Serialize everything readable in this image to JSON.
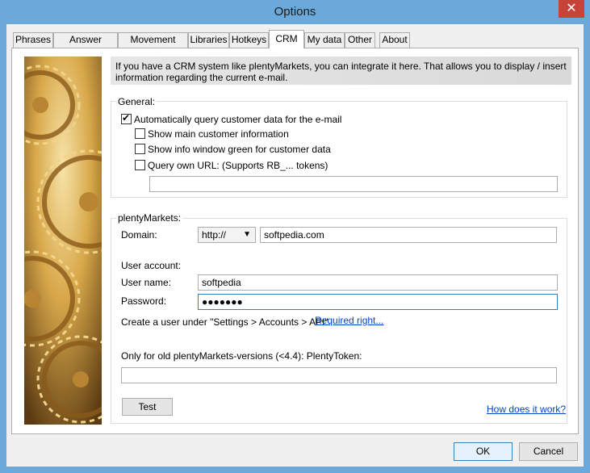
{
  "window": {
    "title": "Options",
    "close_glyph": "✕"
  },
  "tabs": [
    {
      "label": "Phrases"
    },
    {
      "label": "Answer details"
    },
    {
      "label": "Movement rules"
    },
    {
      "label": "Libraries"
    },
    {
      "label": "Hotkeys"
    },
    {
      "label": "CRM"
    },
    {
      "label": "My data"
    },
    {
      "label": "Other"
    },
    {
      "label": "About"
    }
  ],
  "active_tab": "CRM",
  "info": {
    "text": "If you have a CRM system like plentyMarkets, you can integrate it here. That allows you to display / insert information regarding the current e-mail."
  },
  "general": {
    "title": "General:",
    "auto_query": {
      "label": "Automatically query customer data for the e-mail",
      "checked": true
    },
    "show_main": {
      "label": "Show main customer information",
      "checked": false
    },
    "show_green": {
      "label": "Show info window green for customer data",
      "checked": false
    },
    "query_url": {
      "label": "Query own URL: (Supports RB_... tokens)",
      "checked": false
    },
    "url_value": ""
  },
  "plenty": {
    "title": "plentyMarkets:",
    "domain_label": "Domain:",
    "protocol": "http://",
    "domain_value": "softpedia.com",
    "user_account_label": "User account:",
    "username_label": "User name:",
    "username_value": "softpedia",
    "password_label": "Password:",
    "password_value": "●●●●●●●",
    "create_user_text": "Create a user under \"Settings > Accounts > API\".",
    "required_link": "Required right...",
    "token_label": "Only for old plentyMarkets-versions (<4.4): PlentyToken:",
    "token_value": "",
    "test_button": "Test",
    "how_link": "How does it work?"
  },
  "footer": {
    "ok": "OK",
    "cancel": "Cancel"
  },
  "colors": {
    "titlebar": "#6aa9da",
    "close": "#c7433a",
    "link": "#0044cc",
    "focus": "#3c7fb1"
  }
}
